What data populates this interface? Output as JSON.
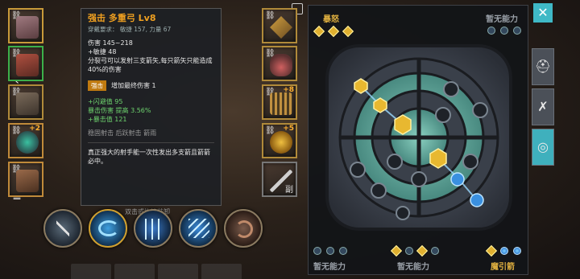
{
  "screen_controls": {
    "back_glyph": "‹",
    "home_glyph": "▢",
    "menu_glyph": "≡"
  },
  "equipment_left": [
    {
      "name": "helmet",
      "badge": ""
    },
    {
      "name": "chest-armor",
      "badge": ""
    },
    {
      "name": "leg-armor",
      "badge": ""
    },
    {
      "name": "ring",
      "badge": "+2"
    },
    {
      "name": "gloves",
      "badge": ""
    }
  ],
  "equipment_right": [
    {
      "name": "crossbow",
      "badge": "",
      "tag": ""
    },
    {
      "name": "potion",
      "badge": "",
      "tag": ""
    },
    {
      "name": "arrow-quiver",
      "badge": "+8",
      "tag": ""
    },
    {
      "name": "amulet",
      "badge": "+5",
      "tag": ""
    },
    {
      "name": "sword",
      "badge": "",
      "tag": "副"
    }
  ],
  "tooltip": {
    "title": "强击 多重弓 Lv8",
    "requirement": "穿戴要求： 敏捷 157, 力量 67",
    "damage": "伤害  145~218",
    "bonus_agility": "+敏捷 48",
    "desc1": "分裂弓可以发射三支箭矢,每只箭矢只能造成40%的伤害",
    "strike_label": "强击",
    "strike_value": "增加最终伤害 1",
    "stat1": "+闪避值 95",
    "stat2": "暴击伤害 提高 3.56%",
    "stat3": "+暴击值 121",
    "keywords": "稳固射击   后跃射击    箭雨",
    "flavor": "真正强大的射手能一次性发出多支箭且箭箭必中。"
  },
  "skills": {
    "label": "双击或拖拽装卸"
  },
  "talent_panel": {
    "top_left_title": "暴怒",
    "top_right_title": "暂无能力",
    "bottom_left_title": "暂无能力",
    "bottom_center_title": "暂无能力",
    "bottom_right_title": "魔引箭"
  },
  "close_glyph": "✕",
  "side_tabs": [
    {
      "name": "helmet-tab",
      "glyph": "⛑"
    },
    {
      "name": "crossed-weapons-tab",
      "glyph": "✗"
    },
    {
      "name": "target-tab",
      "glyph": "◎"
    }
  ],
  "colors": {
    "accent": "#3fb9c6",
    "title_orange": "#f0a020",
    "stat_green": "#6ed36e",
    "gold": "#e0b040"
  }
}
